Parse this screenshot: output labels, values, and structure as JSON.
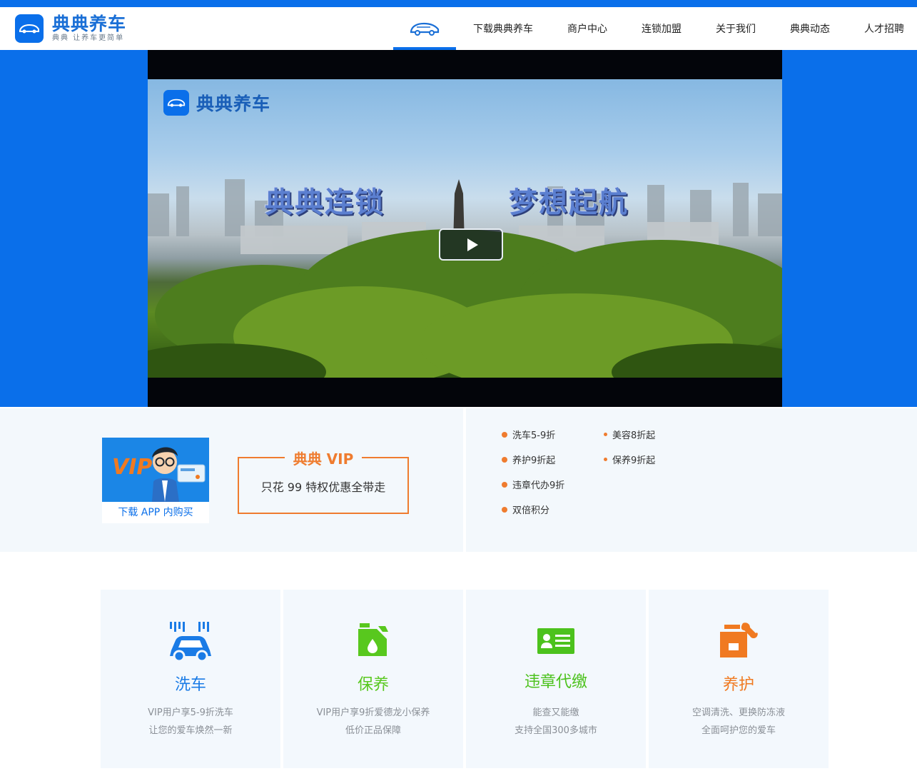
{
  "brand": {
    "name": "典典养车",
    "slogan": "典典 让养车更简单"
  },
  "nav": {
    "home_icon": "car-icon",
    "items": [
      {
        "label": "下载典典养车"
      },
      {
        "label": "商户中心"
      },
      {
        "label": "连锁加盟"
      },
      {
        "label": "关于我们"
      },
      {
        "label": "典典动态"
      },
      {
        "label": "人才招聘"
      }
    ]
  },
  "video": {
    "logo_text": "典典养车",
    "caption_left": "典典连锁",
    "caption_right": "梦想起航",
    "play_icon": "play-icon"
  },
  "vip": {
    "card_badge": "VIP",
    "card_link": "下载 APP 内购买",
    "box_title": "典典 VIP",
    "box_text": "只花 99 特权优惠全带走",
    "perks": [
      {
        "label": "洗车5-9折"
      },
      {
        "label": "美容8折起"
      },
      {
        "label": "养护9折起"
      },
      {
        "label": "保养9折起"
      },
      {
        "label": "违章代办9折"
      },
      {
        "label": "双倍积分"
      }
    ]
  },
  "services": [
    {
      "title": "洗车",
      "line1": "VIP用户享5-9折洗车",
      "line2": "让您的爱车焕然一新",
      "color": "#1a7be6",
      "icon": "car-wash-icon"
    },
    {
      "title": "保养",
      "line1": "VIP用户享9折爱德龙小保养",
      "line2": "低价正品保障",
      "color": "#58c81e",
      "icon": "oil-can-icon"
    },
    {
      "title": "违章代缴",
      "line1": "能查又能缴",
      "line2": "支持全国300多城市",
      "color": "#4cc21d",
      "icon": "license-card-icon"
    },
    {
      "title": "养护",
      "line1": "空调清洗、更换防冻液",
      "line2": "全面呵护您的爱车",
      "color": "#f07a21",
      "icon": "toolbox-icon"
    }
  ],
  "colors": {
    "brand_blue": "#0a6fea",
    "accent_orange": "#ef7c2f"
  }
}
